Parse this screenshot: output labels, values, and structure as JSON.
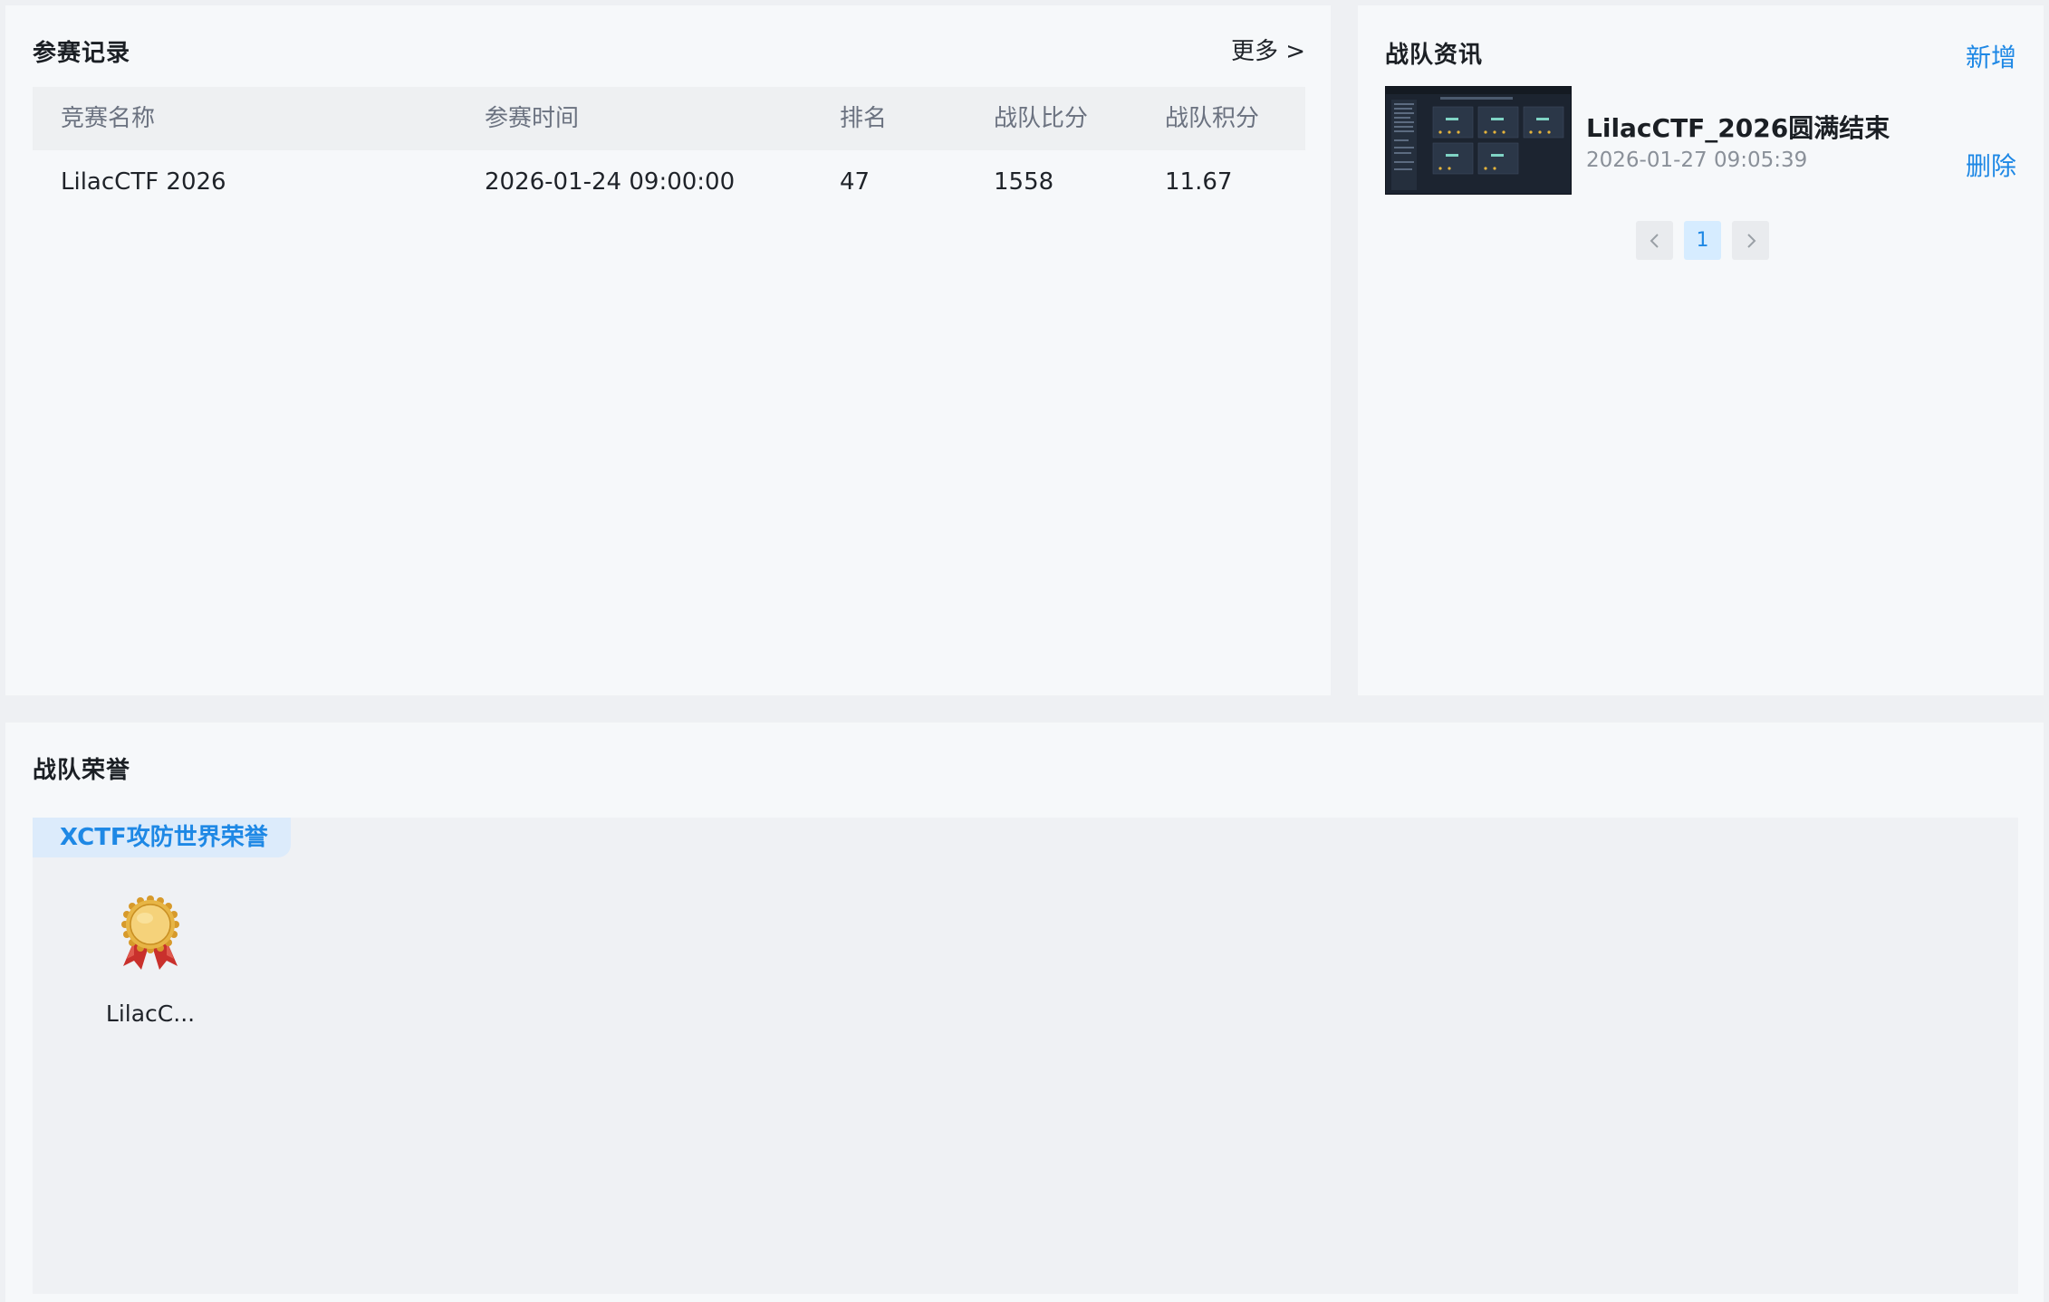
{
  "records": {
    "title": "参赛记录",
    "more_label": "更多 >",
    "columns": [
      "竞赛名称",
      "参赛时间",
      "排名",
      "战队比分",
      "战队积分"
    ],
    "rows": [
      [
        "LilacCTF 2026",
        "2026-01-24 09:00:00",
        "47",
        "1558",
        "11.67"
      ]
    ]
  },
  "news": {
    "title": "战队资讯",
    "add_label": "新增",
    "delete_label": "删除",
    "item_title": "LilacCTF_2026圆满结束",
    "item_time": "2026-01-27 09:05:39",
    "page": "1"
  },
  "honors": {
    "title": "战队荣誉",
    "tab_label": "XCTF攻防世界荣誉",
    "medal_label": "LilacC..."
  },
  "colors": {
    "accent": "#1e88e5",
    "panel_bg": "#f6f8fa",
    "page_bg": "#eef0f3"
  }
}
